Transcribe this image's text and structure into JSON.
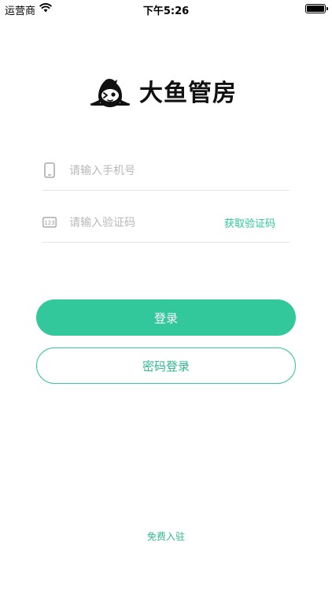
{
  "status_bar": {
    "carrier": "运营商",
    "time": "下午5:26",
    "battery_level": 0.9
  },
  "logo": {
    "text": "大鱼管房",
    "mascot_icon": "penguin-mascot-icon"
  },
  "login_form": {
    "phone": {
      "placeholder": "请输入手机号",
      "icon": "phone-icon"
    },
    "code": {
      "placeholder": "请输入验证码",
      "icon": "numeric-code-icon",
      "icon_text": "123",
      "get_code_label": "获取验证码"
    }
  },
  "buttons": {
    "login_label": "登录",
    "password_login_label": "密码登录"
  },
  "footer": {
    "free_join_label": "免费入驻"
  },
  "colors": {
    "accent": "#33c79c",
    "accent_text": "#2fb98f",
    "placeholder": "#b9b9b9",
    "divider": "#e6e6e6"
  }
}
